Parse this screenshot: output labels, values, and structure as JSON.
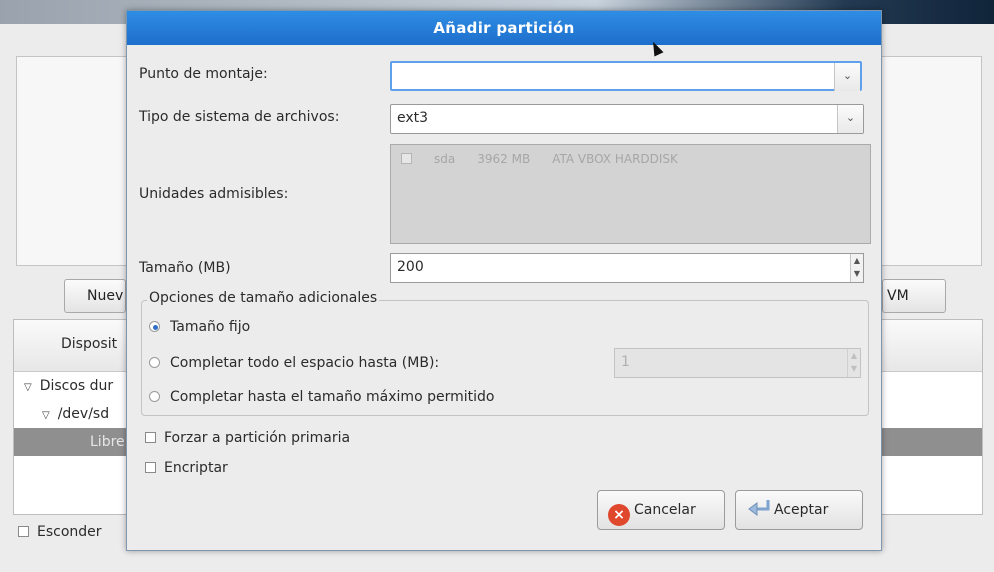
{
  "background": {
    "buttons": {
      "new_label": "Nuev",
      "lvm_label": "VM"
    },
    "tree": {
      "column_header": "Disposit",
      "rows": [
        {
          "label": "Discos dur"
        },
        {
          "label": "/dev/sd"
        },
        {
          "label": "Libre"
        }
      ]
    },
    "hide_checkbox_label": "Esconder"
  },
  "dialog": {
    "title": "Añadir partición",
    "mount_point": {
      "label": "Punto de montaje:",
      "value": ""
    },
    "fs_type": {
      "label": "Tipo de sistema de archivos:",
      "value": "ext3"
    },
    "allowable_drives": {
      "label": "Unidades admisibles:",
      "rows": [
        {
          "device": "sda",
          "size": "3962 MB",
          "model": "ATA VBOX HARDDISK",
          "checked": true
        }
      ]
    },
    "size": {
      "label": "Tamaño (MB)",
      "value": "200"
    },
    "size_options": {
      "title": "Opciones de tamaño adicionales",
      "fixed": "Tamaño fijo",
      "fill_up_to": "Completar todo el espacio hasta (MB):",
      "fill_up_to_value": "1",
      "fill_max": "Completar hasta el tamaño máximo permitido",
      "selected": "fixed"
    },
    "force_primary": "Forzar a partición primaria",
    "encrypt": "Encriptar",
    "cancel_label": "Cancelar",
    "accept_label": "Aceptar"
  },
  "colors": {
    "titlebar": "#1f76d2",
    "cancel_icon": "#e0482e",
    "accent_focus": "#5ea0ea"
  }
}
